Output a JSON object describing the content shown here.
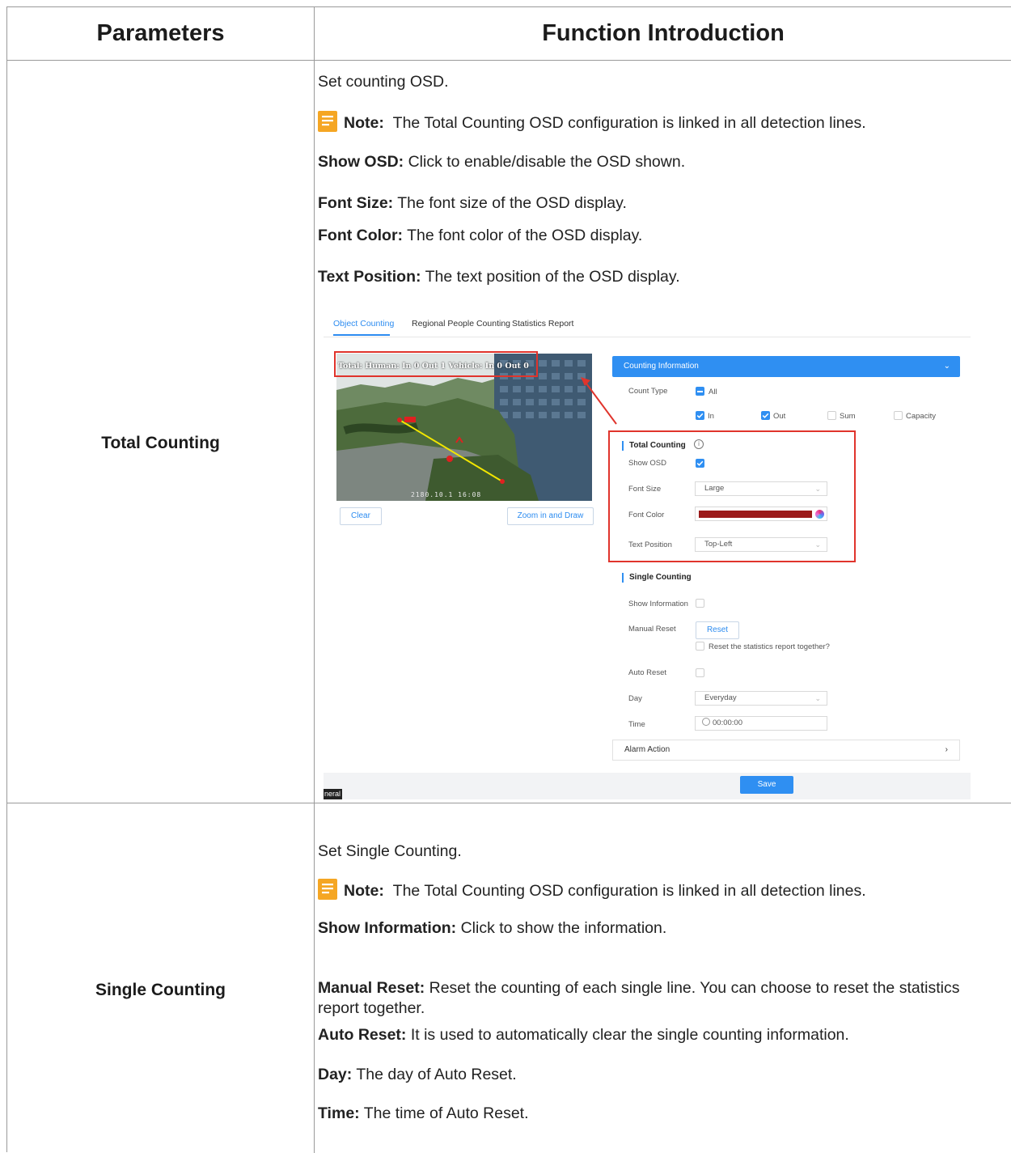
{
  "table": {
    "header": {
      "parameters": "Parameters",
      "function": "Function Introduction"
    },
    "row1": {
      "label": "Total Counting",
      "intro": "Set counting OSD.",
      "note_label": "Note:",
      "note_text": "The Total Counting OSD configuration is linked in all detection lines.",
      "items": [
        {
          "term": "Show OSD:",
          "desc": "Click to enable/disable the OSD shown."
        },
        {
          "term": "Font Size:",
          "desc": "The font size of the OSD display."
        },
        {
          "term": "Font Color:",
          "desc": "The font color of the OSD display."
        },
        {
          "term": "Text Position:",
          "desc": "The text position of the OSD display."
        }
      ]
    },
    "row2": {
      "label": "Single Counting",
      "intro": "Set Single Counting.",
      "note_label": "Note:",
      "note_text": "The Total Counting OSD configuration is linked in all detection lines.",
      "items": [
        {
          "term": "Show Information:",
          "desc": "Click to show the information."
        },
        {
          "term": "Manual Reset:",
          "desc": "Reset the counting of each single line. You can choose to reset the statistics report together."
        },
        {
          "term": "Auto Reset:",
          "desc": "It is used to automatically clear the single counting information."
        },
        {
          "term": "Day:",
          "desc": "The day of Auto Reset."
        },
        {
          "term": "Time:",
          "desc": "The time of Auto Reset."
        }
      ]
    }
  },
  "screenshot": {
    "tabs": [
      "Object Counting",
      "Regional People Counting",
      "Statistics Report"
    ],
    "video_osd": "Total: Human: In 0  Out 1  Vehicle: In 0  Out 0",
    "video_timestamp": "2180.10.1   16:08",
    "clear_label": "Clear",
    "zoom_label": "Zoom in and Draw",
    "counting_info_label": "Counting Information",
    "count_type_label": "Count Type",
    "count_all_label": "All",
    "count_in_label": "In",
    "count_out_label": "Out",
    "count_sum_label": "Sum",
    "count_capacity_label": "Capacity",
    "total_counting_title": "Total Counting",
    "show_osd_label": "Show OSD",
    "font_size_label": "Font Size",
    "font_size_value": "Large",
    "font_color_label": "Font Color",
    "font_color_value": "#9b1a1a",
    "text_position_label": "Text Position",
    "text_position_value": "Top-Left",
    "single_counting_title": "Single Counting",
    "show_information_label": "Show Information",
    "manual_reset_label": "Manual Reset",
    "reset_button": "Reset",
    "reset_together_label": "Reset the statistics report together?",
    "auto_reset_label": "Auto Reset",
    "day_label": "Day",
    "day_value": "Everyday",
    "time_label": "Time",
    "time_value": "00:00:00",
    "alarm_action_label": "Alarm Action",
    "save_label": "Save",
    "corner_tag": "neral"
  }
}
